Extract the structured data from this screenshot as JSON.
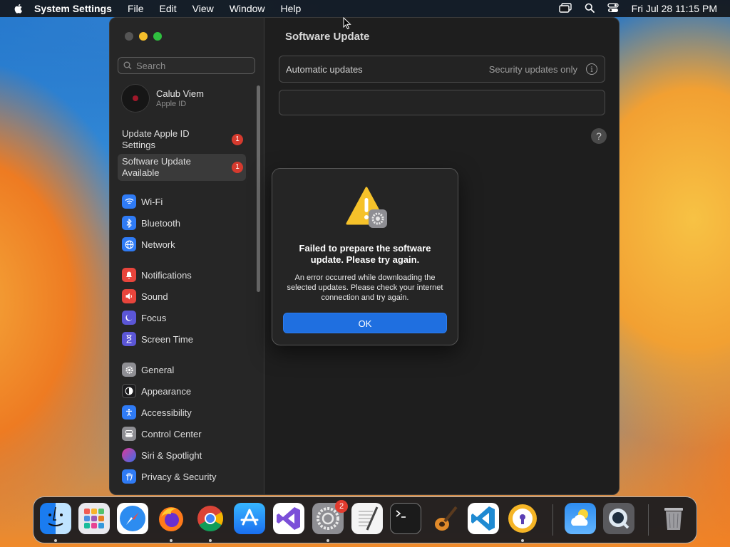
{
  "menubar": {
    "app_name": "System Settings",
    "menus": [
      "File",
      "Edit",
      "View",
      "Window",
      "Help"
    ],
    "datetime": "Fri Jul 28  11:15 PM"
  },
  "window": {
    "search_placeholder": "Search",
    "profile": {
      "name": "Calub Viem",
      "subtitle": "Apple ID"
    },
    "alerts": [
      {
        "label_line1": "Update Apple ID",
        "label_line2": "Settings",
        "badge": "1"
      },
      {
        "label_line1": "Software Update",
        "label_line2": "Available",
        "badge": "1"
      }
    ],
    "sidebar_items": [
      {
        "label": "Wi-Fi",
        "icon": "wifi-icon",
        "color": "#2f7bf5"
      },
      {
        "label": "Bluetooth",
        "icon": "bluetooth-icon",
        "color": "#2f7bf5"
      },
      {
        "label": "Network",
        "icon": "globe-icon",
        "color": "#2f7bf5"
      },
      {
        "label": "Notifications",
        "icon": "bell-icon",
        "color": "#e8453c"
      },
      {
        "label": "Sound",
        "icon": "speaker-icon",
        "color": "#e8453c"
      },
      {
        "label": "Focus",
        "icon": "moon-icon",
        "color": "#5b56d6"
      },
      {
        "label": "Screen Time",
        "icon": "hourglass-icon",
        "color": "#5b56d6"
      },
      {
        "label": "General",
        "icon": "gear-icon",
        "color": "#8e8e93"
      },
      {
        "label": "Appearance",
        "icon": "appearance-icon",
        "color": "#1c1c1e"
      },
      {
        "label": "Accessibility",
        "icon": "accessibility-icon",
        "color": "#2f7bf5"
      },
      {
        "label": "Control Center",
        "icon": "control-center-icon",
        "color": "#8e8e93"
      },
      {
        "label": "Siri & Spotlight",
        "icon": "siri-icon",
        "color": "#b03ad9"
      },
      {
        "label": "Privacy & Security",
        "icon": "hand-icon",
        "color": "#2f7bf5"
      }
    ],
    "content": {
      "title": "Software Update",
      "automatic_updates_label": "Automatic updates",
      "automatic_updates_value": "Security updates only",
      "info_glyph": "i",
      "help_glyph": "?"
    }
  },
  "dialog": {
    "title": "Failed to prepare the software update. Please try again.",
    "message": "An error occurred while downloading the selected updates. Please check your internet connection and try again.",
    "ok_label": "OK"
  },
  "dock": {
    "apps": [
      "finder-icon",
      "launchpad-icon",
      "safari-icon",
      "firefox-icon",
      "chrome-icon",
      "app-store-icon",
      "visual-studio-icon",
      "system-settings-icon",
      "textedit-icon",
      "terminal-icon",
      "garageband-icon",
      "vscode-icon",
      "keychain-icon",
      "weather-icon",
      "quicktime-icon",
      "trash-icon"
    ],
    "settings_badge": "2"
  }
}
